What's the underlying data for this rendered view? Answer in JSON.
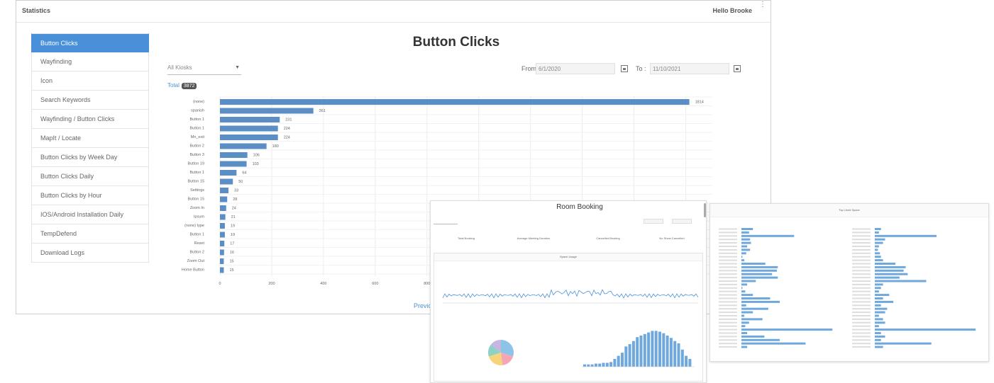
{
  "header": {
    "app_title": "Statistics",
    "greeting": "Hello Brooke"
  },
  "sidebar": {
    "items": [
      {
        "label": "Button Clicks",
        "active": true
      },
      {
        "label": "Wayfinding"
      },
      {
        "label": "Icon"
      },
      {
        "label": "Search Keywords"
      },
      {
        "label": "Wayfinding / Button Clicks"
      },
      {
        "label": "MapIt / Locate"
      },
      {
        "label": "Button Clicks by Week Day"
      },
      {
        "label": "Button Clicks Daily"
      },
      {
        "label": "Button Clicks by Hour"
      },
      {
        "label": "IOS/Android Installation Daily"
      },
      {
        "label": "TempDefend"
      },
      {
        "label": "Download Logs"
      }
    ]
  },
  "main": {
    "title": "Button Clicks",
    "kiosk_select": "All Kiosks",
    "from_label": "From :",
    "from_value": "6/1/2020",
    "to_label": "To :",
    "to_value": "11/10/2021",
    "total_label": "Total",
    "total_value": "3872",
    "pagination_prev": "Previo"
  },
  "chart_data": [
    {
      "type": "bar",
      "orientation": "horizontal",
      "categories": [
        "(none)",
        "spanish",
        "Button 1",
        "Button 1",
        "Mn_exit",
        "Button 2",
        "Button 3",
        "Button 19",
        "Button 1",
        "Button 15",
        "Settings",
        "Button 15",
        "Zoom In",
        "Ipsum",
        "(none) type",
        "Button 1",
        "Reset",
        "Button 2",
        "Zoom Out",
        "Home Button"
      ],
      "values": [
        1814,
        361,
        231,
        224,
        224,
        180,
        106,
        103,
        64,
        50,
        33,
        28,
        24,
        21,
        19,
        19,
        17,
        16,
        15,
        15
      ],
      "xticks": [
        0,
        200,
        400,
        600,
        800
      ],
      "xlim": [
        0,
        1900
      ],
      "color": "#5b8ec4",
      "grid": true
    }
  ],
  "overlay_room": {
    "title": "Room Booking",
    "space_usage_label": "Space Usage",
    "stats": [
      "Total Booking",
      "Average Meeting Duration",
      "Cancelled Booking",
      "No Show Cancelled"
    ],
    "bar_values": [
      3,
      3,
      3,
      4,
      4,
      5,
      5,
      6,
      10,
      14,
      18,
      26,
      29,
      33,
      38,
      40,
      42,
      44,
      46,
      46,
      45,
      43,
      40,
      37,
      33,
      30,
      22,
      14,
      10
    ],
    "pie_colors": [
      "#8ec3e8",
      "#f4a6b5",
      "#f6d57a",
      "#8fd1c4",
      "#c8b6e2"
    ]
  },
  "overlay_space": {
    "title": "Top Used Space",
    "left_values": [
      12,
      8,
      55,
      9,
      10,
      6,
      9,
      5,
      1,
      3,
      25,
      38,
      37,
      32,
      38,
      15,
      6,
      1,
      4,
      12,
      30,
      40,
      5,
      28,
      12,
      3,
      22,
      8,
      4,
      95,
      6,
      24,
      40,
      67,
      6
    ],
    "right_values": [
      6,
      4,
      60,
      10,
      8,
      4,
      3,
      5,
      6,
      8,
      20,
      30,
      28,
      32,
      24,
      50,
      8,
      6,
      4,
      14,
      8,
      18,
      6,
      12,
      10,
      4,
      8,
      10,
      4,
      98,
      6,
      10,
      6,
      55,
      8
    ]
  }
}
